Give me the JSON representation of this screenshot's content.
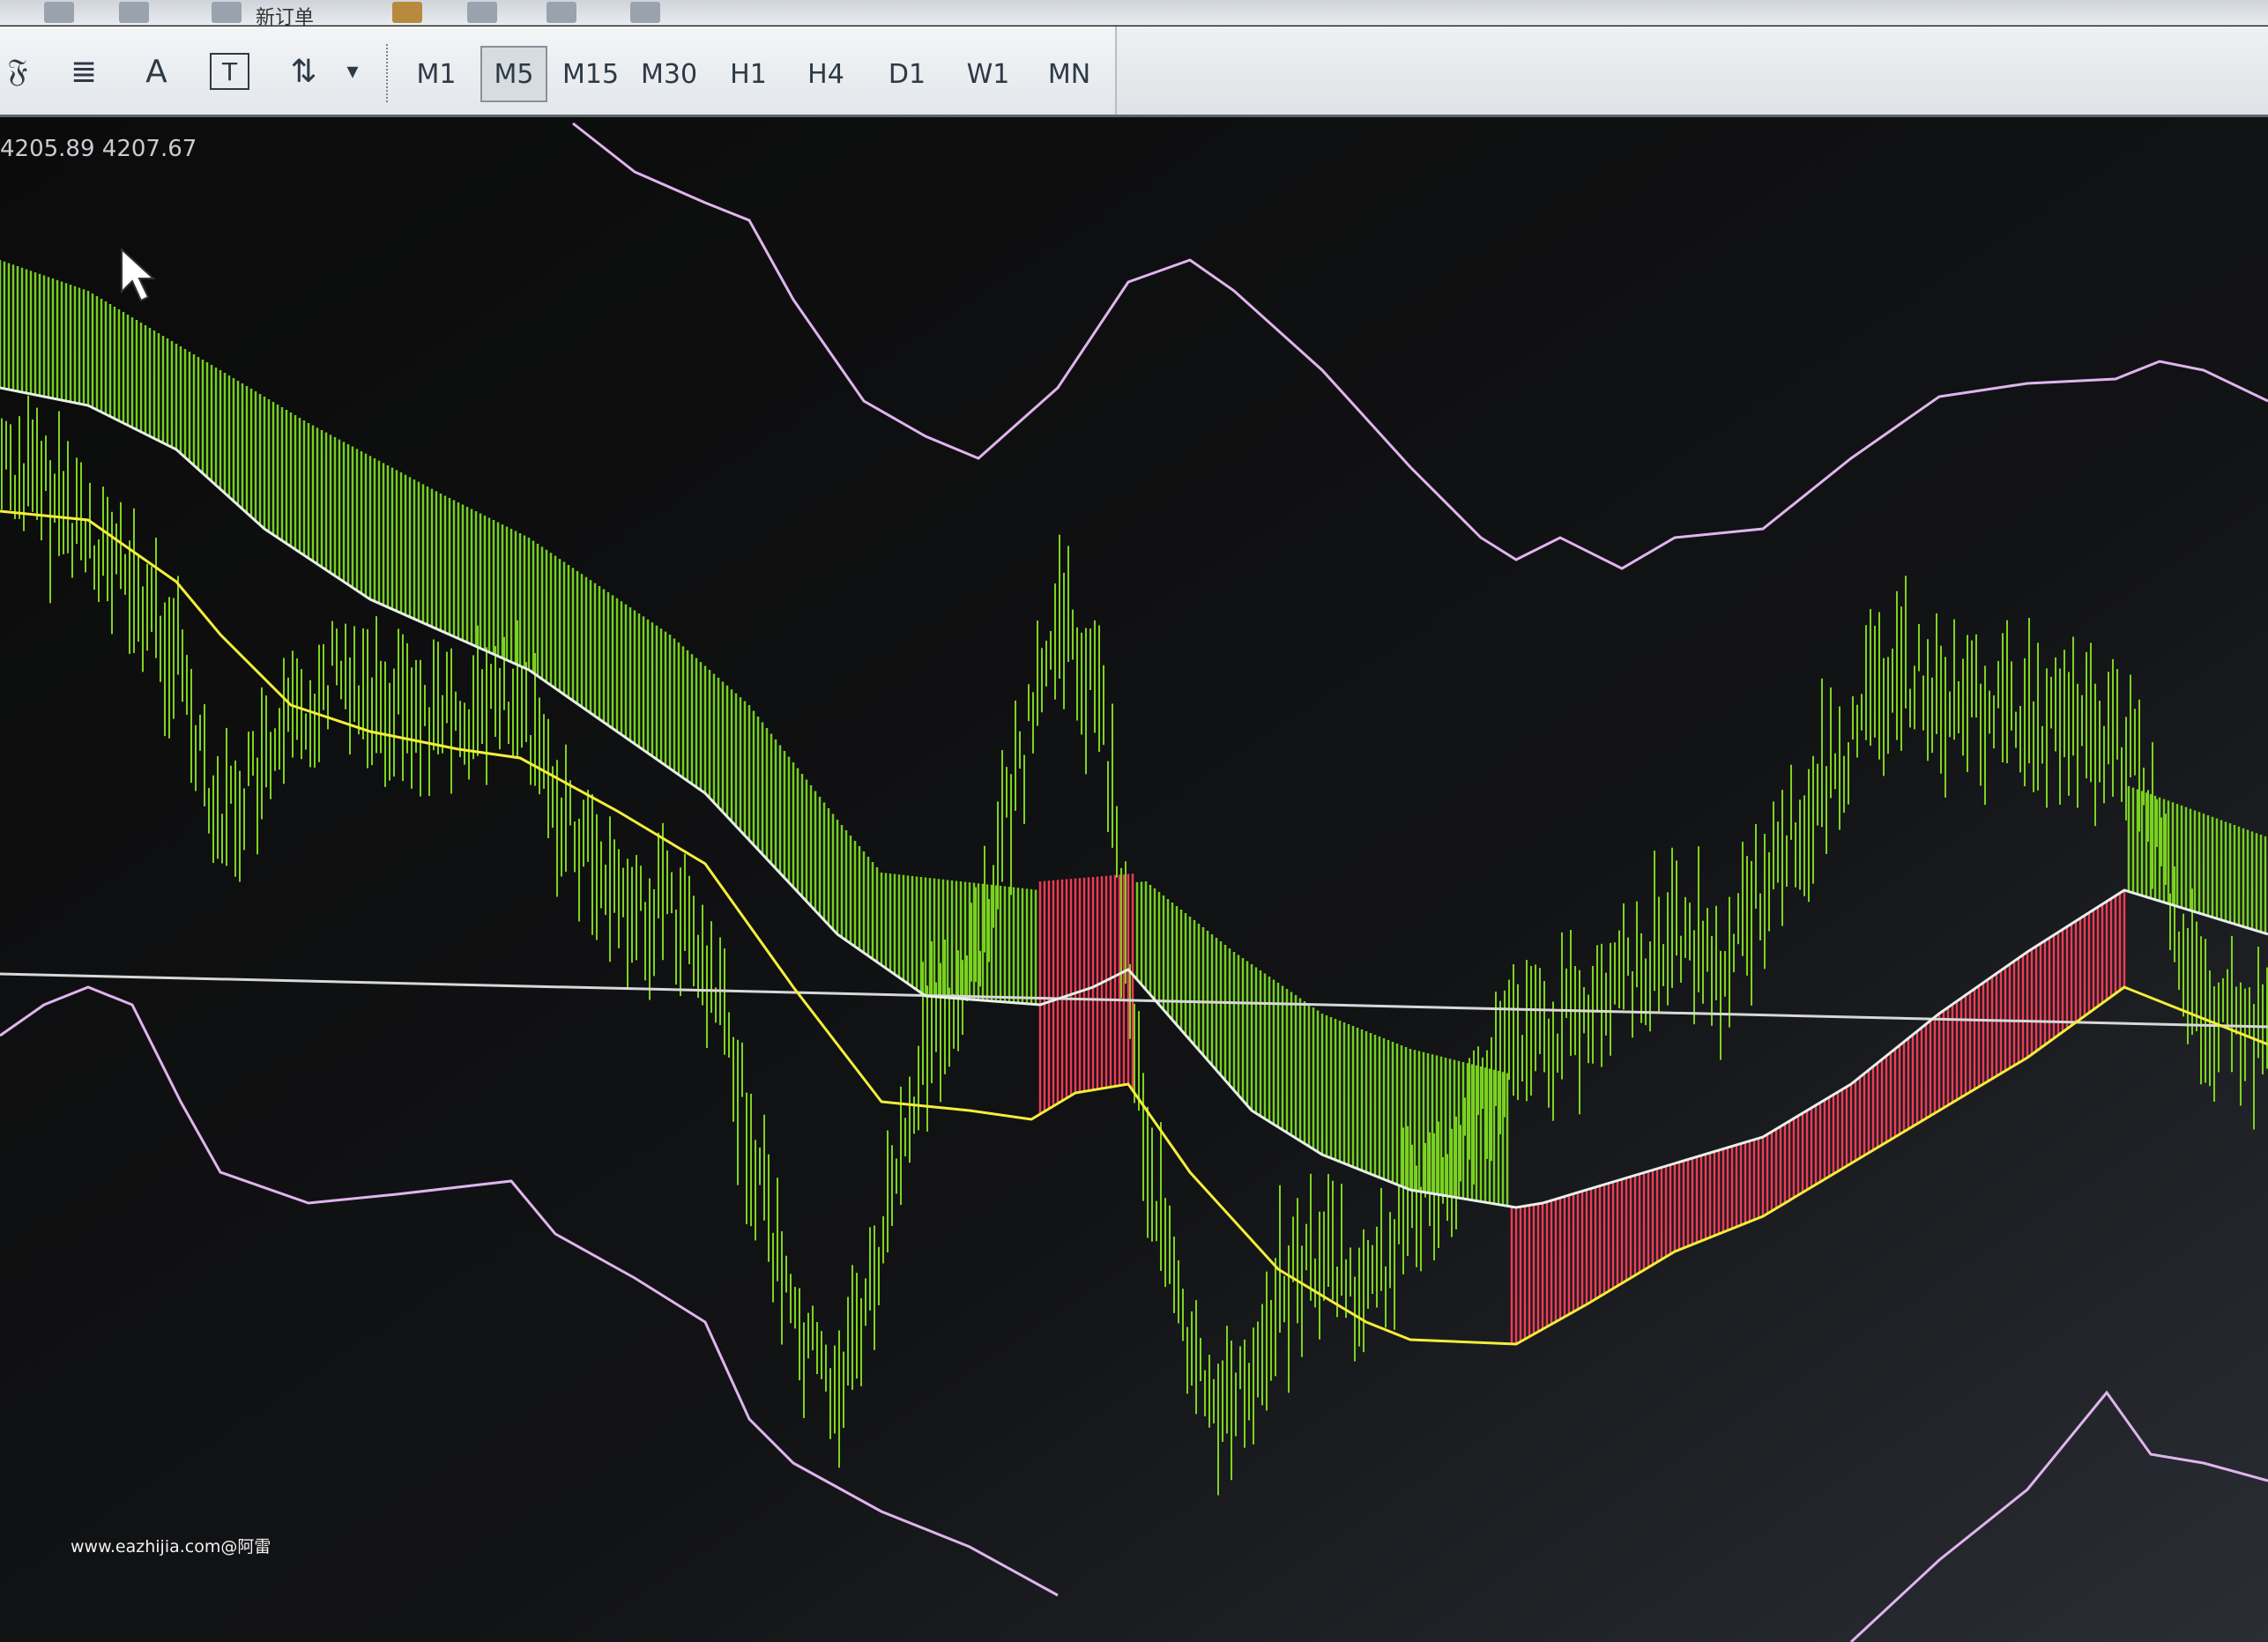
{
  "toolbar": {
    "top_items": [
      {
        "icon": "document-icon"
      },
      {
        "icon": "chart-zoom-icon"
      },
      {
        "icon": "new-order-icon",
        "label": "新订单"
      },
      {
        "icon": "folder-icon"
      },
      {
        "icon": "cloud-icon"
      },
      {
        "icon": "globe-icon"
      },
      {
        "icon": "auto-trading-icon"
      }
    ],
    "drawing_tools": [
      {
        "name": "fibonacci-expansion-icon",
        "glyph": "𝔉"
      },
      {
        "name": "fibonacci-lines-icon",
        "glyph": "≣"
      },
      {
        "name": "text-tool-icon",
        "glyph": "A"
      },
      {
        "name": "text-label-icon",
        "glyph": "T"
      },
      {
        "name": "arrows-icon",
        "glyph": "⇅"
      },
      {
        "name": "dropdown-arrow-icon",
        "glyph": "▾"
      }
    ],
    "timeframes": [
      "M1",
      "M5",
      "M15",
      "M30",
      "H1",
      "H4",
      "D1",
      "W1",
      "MN"
    ],
    "active_timeframe": "M5"
  },
  "chart": {
    "price_readout": "4205.89 4207.67",
    "colors": {
      "background": "#0d0d0d",
      "bars": "#7fd31e",
      "band_bull": "#7ee022",
      "band_bear": "#ff3f5a",
      "ma_upper": "#e8f0ea",
      "ma_lower": "#f4ee3a",
      "envelope": "#e0b4ee",
      "horizontal_line": "#d8d8d8"
    }
  },
  "watermark": "www.eazhijia.com@阿雷"
}
